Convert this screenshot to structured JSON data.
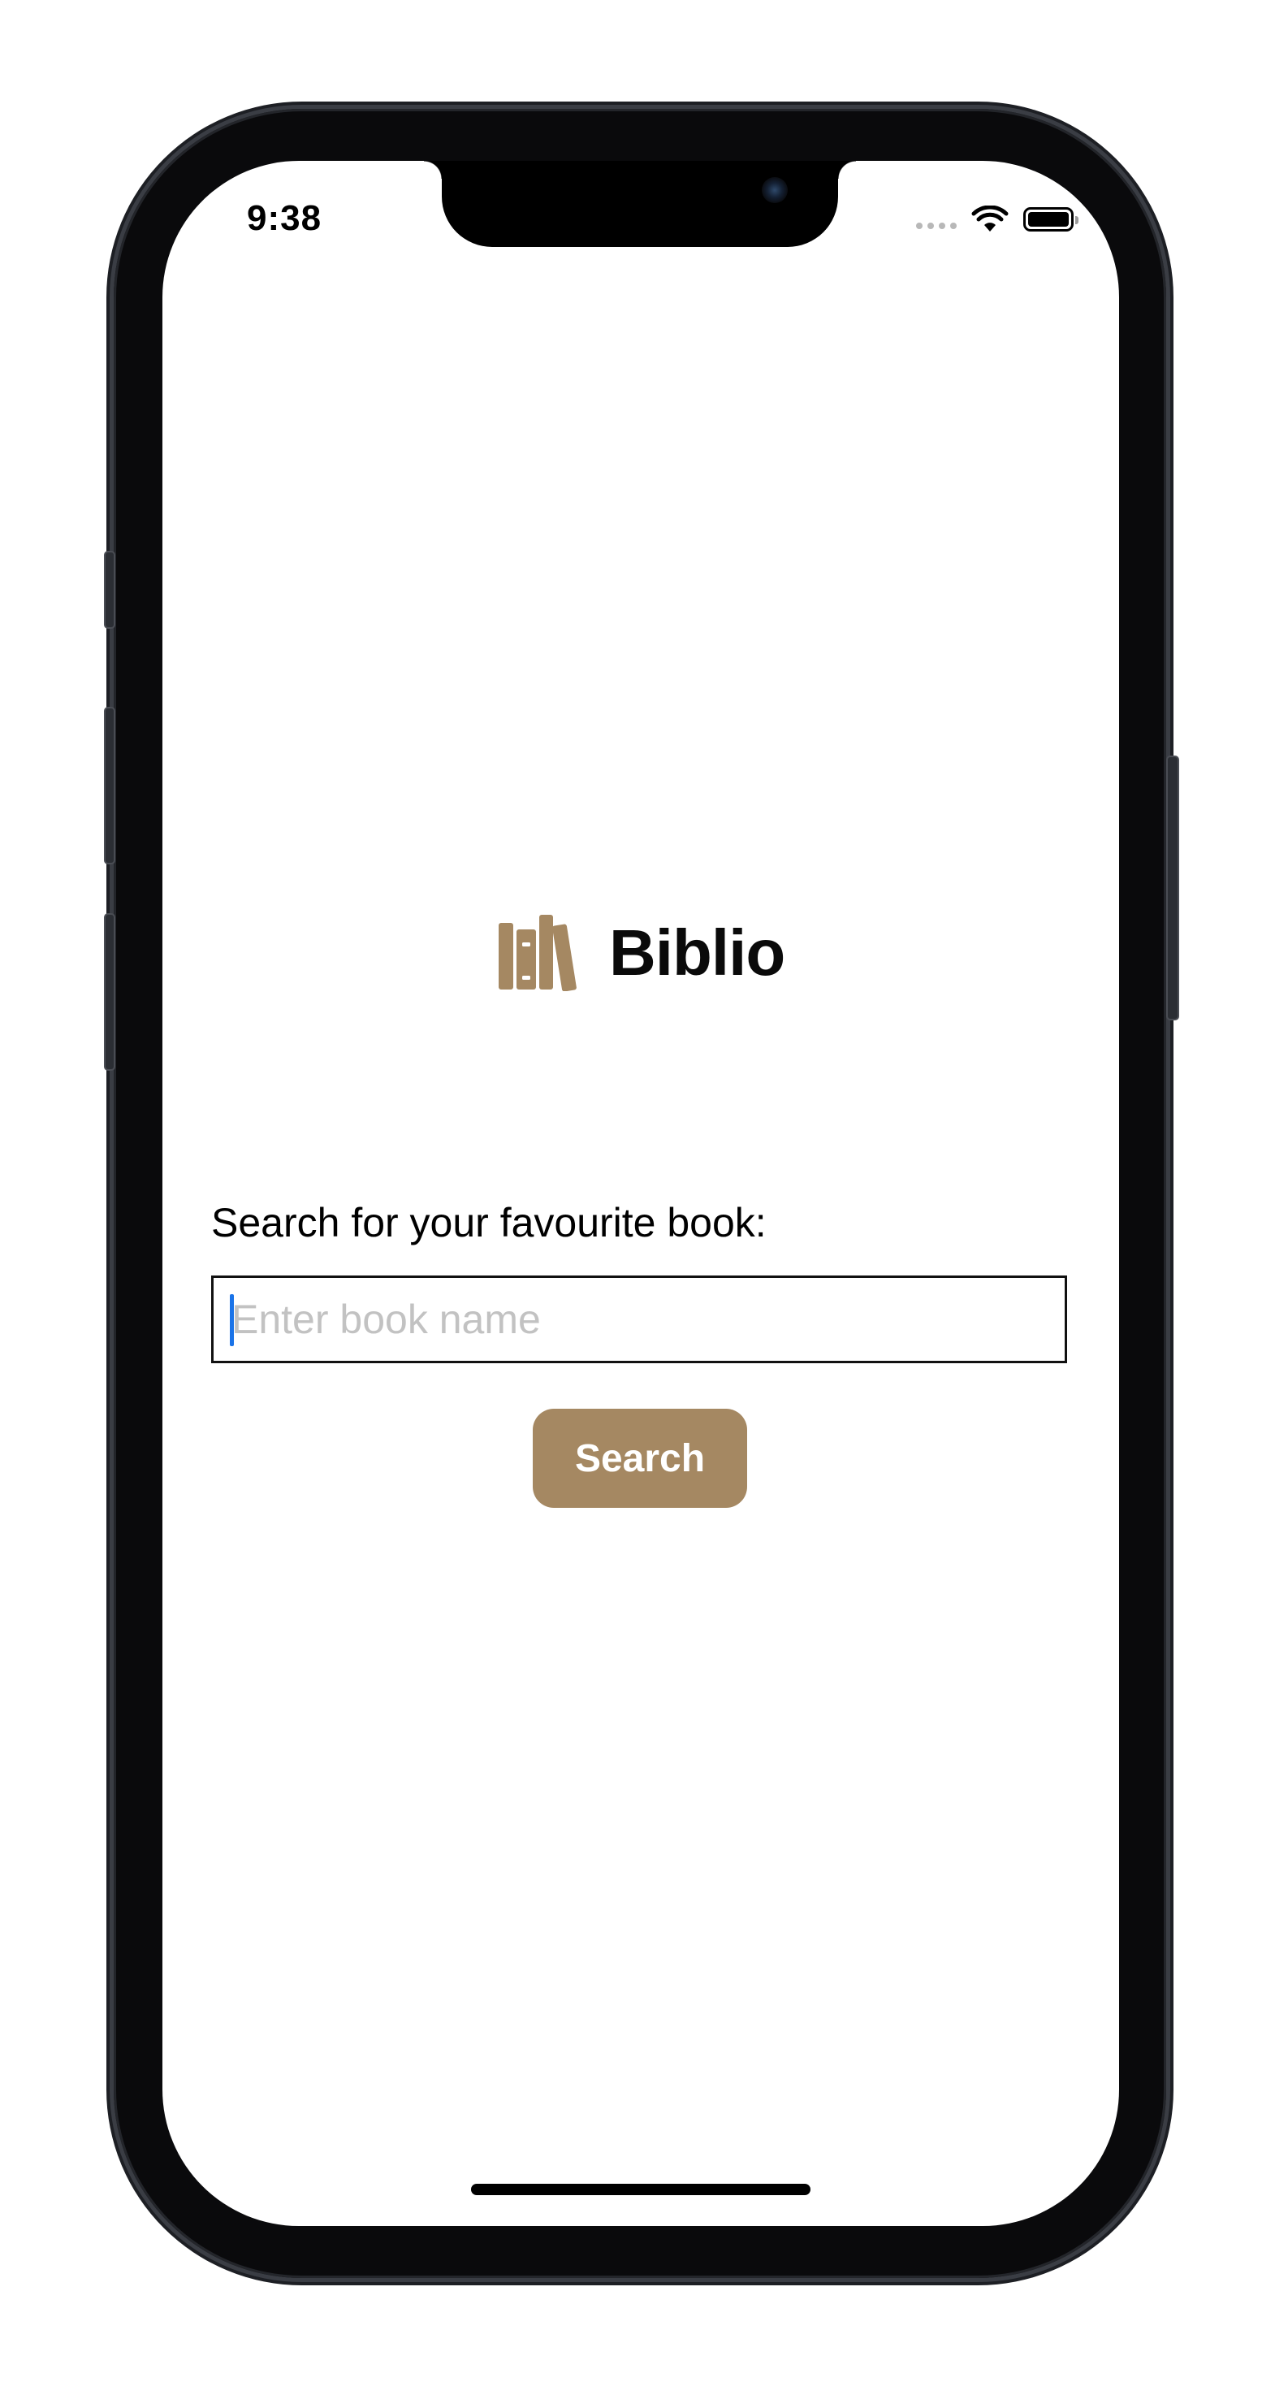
{
  "status_bar": {
    "time": "9:38"
  },
  "brand": {
    "title": "Biblio",
    "icon": "books-icon",
    "accent_color": "#a58862"
  },
  "search": {
    "label": "Search for your favourite book:",
    "placeholder": "Enter book name",
    "value": "",
    "button_label": "Search"
  }
}
